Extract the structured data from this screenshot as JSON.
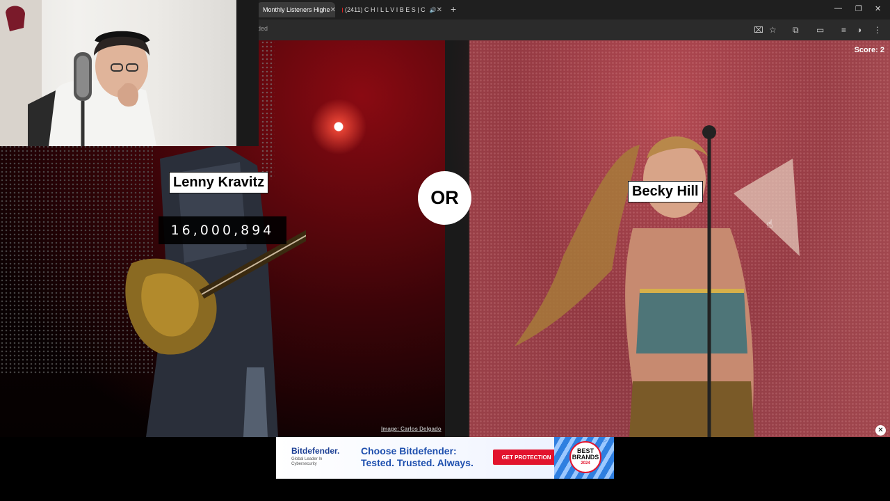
{
  "browser": {
    "tabs": [
      {
        "title": "Monthly Listeners Highe",
        "active": true
      },
      {
        "title": "(2411) C H I L L V I B E S | C",
        "active": false
      }
    ],
    "url_fragment": "ded",
    "new_tab": "+",
    "window_controls": {
      "minimize": "—",
      "maximize": "❐",
      "close": "✕"
    }
  },
  "game": {
    "score": "Score: 2",
    "left": {
      "artist": "Lenny Kravitz",
      "monthly_listeners": "16,000,894"
    },
    "right": {
      "artist": "Becky Hill"
    },
    "versus": "OR",
    "image_credit": "Image: Carlos Delgado"
  },
  "ad": {
    "brand": "Bitdefender.",
    "tagline": "Global Leader In Cybersecurity",
    "headline_line1": "Choose Bitdefender:",
    "headline_line2": "Tested. Trusted. Always.",
    "cta": "GET PROTECTION",
    "badge_line1": "BEST",
    "badge_line2": "BRANDS",
    "badge_line3": "2024",
    "adchoices": "▷ ✕",
    "close": "✕"
  },
  "colors": {
    "accent": "#e2142d",
    "ad_blue": "#1e4fae",
    "tab_bar": "#1f1f1f"
  }
}
